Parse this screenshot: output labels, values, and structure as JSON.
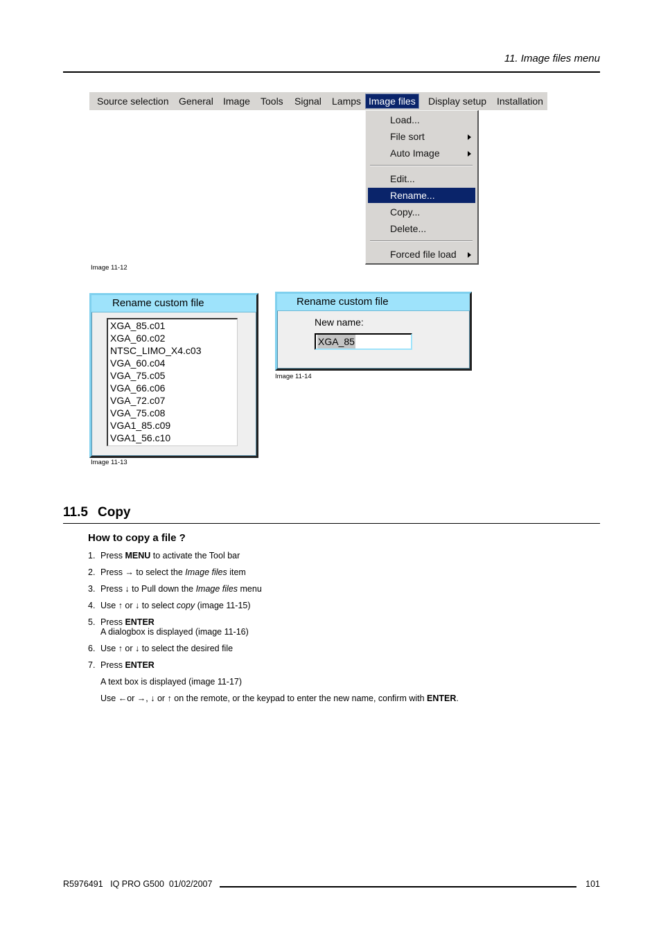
{
  "header": {
    "running_head": "11.  Image files menu"
  },
  "menubar": {
    "items": [
      {
        "label": "Source selection",
        "active": false
      },
      {
        "label": "General",
        "active": false
      },
      {
        "label": "Image",
        "active": false
      },
      {
        "label": "Tools",
        "active": false
      },
      {
        "label": "Signal",
        "active": false
      },
      {
        "label": "Lamps",
        "active": false
      },
      {
        "label": "Image files",
        "active": true
      },
      {
        "label": "Display setup",
        "active": false
      },
      {
        "label": "Installation",
        "active": false
      }
    ]
  },
  "dropdown": {
    "items": [
      {
        "label": "Load...",
        "submenu": false,
        "selected": false
      },
      {
        "label": "File sort",
        "submenu": true,
        "selected": false
      },
      {
        "label": "Auto Image",
        "submenu": true,
        "selected": false
      },
      {
        "label": "Edit...",
        "submenu": false,
        "selected": false
      },
      {
        "label": "Rename...",
        "submenu": false,
        "selected": true
      },
      {
        "label": "Copy...",
        "submenu": false,
        "selected": false
      },
      {
        "label": "Delete...",
        "submenu": false,
        "selected": false
      },
      {
        "label": "Forced file load",
        "submenu": true,
        "selected": false
      }
    ]
  },
  "captions": {
    "image_11_12": "Image 11-12",
    "image_11_13": "Image 11-13",
    "image_11_14": "Image 11-14"
  },
  "dialog_list": {
    "title": "Rename custom file",
    "files": [
      "XGA_85.c01",
      "XGA_60.c02",
      "NTSC_LIMO_X4.c03",
      "VGA_60.c04",
      "VGA_75.c05",
      "VGA_66.c06",
      "VGA_72.c07",
      "VGA_75.c08",
      "VGA1_85.c09",
      "VGA1_56.c10"
    ]
  },
  "dialog_name": {
    "title": "Rename custom file",
    "label": "New name:",
    "value": "XGA_85"
  },
  "section": {
    "number": "11.5",
    "title": "Copy",
    "subtitle": "How to copy a file ?"
  },
  "steps": {
    "s1": {
      "n": "1.",
      "a": "Press ",
      "b": "MENU",
      "c": " to activate the Tool bar"
    },
    "s2": {
      "n": "2.",
      "a": "Press → to select the ",
      "i": "Image files",
      "c": " item"
    },
    "s3": {
      "n": "3.",
      "a": "Press ↓ to Pull down the ",
      "i": "Image files",
      "c": " menu"
    },
    "s4": {
      "n": "4.",
      "a": "Use ↑ or ↓ to select ",
      "i": "copy",
      "c": " (image 11-15)"
    },
    "s5": {
      "n": "5.",
      "a": "Press ",
      "b": "ENTER",
      "sub": "A dialogbox is displayed (image 11-16)"
    },
    "s6": {
      "n": "6.",
      "a": "Use ↑ or ↓ to select the desired file"
    },
    "s7": {
      "n": "7.",
      "a": "Press ",
      "b": "ENTER",
      "sub1": "A text box is displayed (image 11-17)",
      "sub2a": "Use ←or →, ↓ or ↑ on the remote, or the keypad to enter the new name, confirm with ",
      "sub2b": "ENTER",
      "sub2c": "."
    }
  },
  "footer": {
    "left": "R5976491   IQ PRO G500  01/02/2007",
    "page": "101"
  }
}
